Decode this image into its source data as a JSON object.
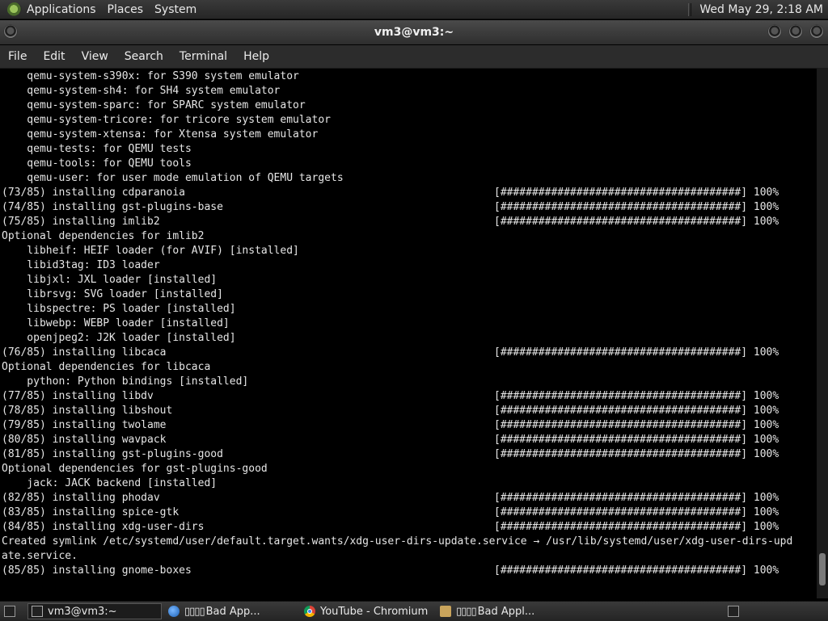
{
  "top_panel": {
    "menus": [
      "Applications",
      "Places",
      "System"
    ],
    "clock": "Wed May 29,  2:18 AM"
  },
  "window": {
    "title": "vm3@vm3:~",
    "menu": [
      "File",
      "Edit",
      "View",
      "Search",
      "Terminal",
      "Help"
    ]
  },
  "terminal": {
    "lines": [
      {
        "text": "    qemu-system-s390x: for S390 system emulator",
        "right": ""
      },
      {
        "text": "    qemu-system-sh4: for SH4 system emulator",
        "right": ""
      },
      {
        "text": "    qemu-system-sparc: for SPARC system emulator",
        "right": ""
      },
      {
        "text": "    qemu-system-tricore: for tricore system emulator",
        "right": ""
      },
      {
        "text": "    qemu-system-xtensa: for Xtensa system emulator",
        "right": ""
      },
      {
        "text": "    qemu-tests: for QEMU tests",
        "right": ""
      },
      {
        "text": "    qemu-tools: for QEMU tools",
        "right": ""
      },
      {
        "text": "    qemu-user: for user mode emulation of QEMU targets",
        "right": ""
      },
      {
        "text": "(73/85) installing cdparanoia",
        "right": "[######################################] 100%"
      },
      {
        "text": "(74/85) installing gst-plugins-base",
        "right": "[######################################] 100%"
      },
      {
        "text": "(75/85) installing imlib2",
        "right": "[######################################] 100%"
      },
      {
        "text": "Optional dependencies for imlib2",
        "right": ""
      },
      {
        "text": "    libheif: HEIF loader (for AVIF) [installed]",
        "right": ""
      },
      {
        "text": "    libid3tag: ID3 loader",
        "right": ""
      },
      {
        "text": "    libjxl: JXL loader [installed]",
        "right": ""
      },
      {
        "text": "    librsvg: SVG loader [installed]",
        "right": ""
      },
      {
        "text": "    libspectre: PS loader [installed]",
        "right": ""
      },
      {
        "text": "    libwebp: WEBP loader [installed]",
        "right": ""
      },
      {
        "text": "    openjpeg2: J2K loader [installed]",
        "right": ""
      },
      {
        "text": "(76/85) installing libcaca",
        "right": "[######################################] 100%"
      },
      {
        "text": "Optional dependencies for libcaca",
        "right": ""
      },
      {
        "text": "    python: Python bindings [installed]",
        "right": ""
      },
      {
        "text": "(77/85) installing libdv",
        "right": "[######################################] 100%"
      },
      {
        "text": "(78/85) installing libshout",
        "right": "[######################################] 100%"
      },
      {
        "text": "(79/85) installing twolame",
        "right": "[######################################] 100%"
      },
      {
        "text": "(80/85) installing wavpack",
        "right": "[######################################] 100%"
      },
      {
        "text": "(81/85) installing gst-plugins-good",
        "right": "[######################################] 100%"
      },
      {
        "text": "Optional dependencies for gst-plugins-good",
        "right": ""
      },
      {
        "text": "    jack: JACK backend [installed]",
        "right": ""
      },
      {
        "text": "(82/85) installing phodav",
        "right": "[######################################] 100%"
      },
      {
        "text": "(83/85) installing spice-gtk",
        "right": "[######################################] 100%"
      },
      {
        "text": "(84/85) installing xdg-user-dirs",
        "right": "[######################################] 100%"
      },
      {
        "text": "Created symlink /etc/systemd/user/default.target.wants/xdg-user-dirs-update.service → /usr/lib/systemd/user/xdg-user-dirs-upd",
        "right": ""
      },
      {
        "text": "ate.service.",
        "right": ""
      },
      {
        "text": "(85/85) installing gnome-boxes",
        "right": "[######################################] 100%"
      }
    ]
  },
  "taskbar": {
    "tasks": [
      {
        "label": "vm3@vm3:~",
        "icon": "terminal-icon",
        "boxes": ""
      },
      {
        "label": "Bad App...",
        "icon": "globe-icon",
        "boxes": "▯▯▯▯"
      },
      {
        "label": "YouTube - Chromium",
        "icon": "chromium-icon",
        "boxes": ""
      },
      {
        "label": "Bad Appl...",
        "icon": "folder-icon",
        "boxes": "▯▯▯▯"
      }
    ]
  }
}
